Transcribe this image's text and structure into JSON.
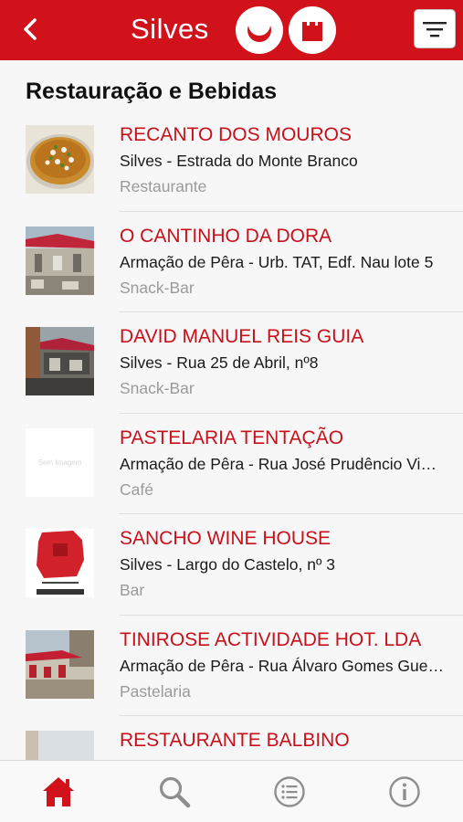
{
  "header": {
    "title": "Silves",
    "back_icon": "back-chevron-icon",
    "moon_icon": "crescent-moon-icon",
    "castle_icon": "castle-tower-icon",
    "filter_icon": "filter-icon",
    "color": "#d1121b"
  },
  "section": {
    "title": "Restauração e Bebidas"
  },
  "items": [
    {
      "name": "RECANTO DOS MOUROS",
      "address": "Silves - Estrada do Monte Branco",
      "category": "Restaurante"
    },
    {
      "name": "O CANTINHO DA DORA",
      "address": "Armação de Pêra - Urb. TAT, Edf. Nau lote 5",
      "category": "Snack-Bar"
    },
    {
      "name": "DAVID MANUEL REIS GUIA",
      "address": "Silves - Rua 25 de Abril, nº8",
      "category": "Snack-Bar"
    },
    {
      "name": "PASTELARIA TENTAÇÃO",
      "address": "Armação de Pêra - Rua José Prudêncio Vieira",
      "category": "Café",
      "image_placeholder": "Sem Imagem"
    },
    {
      "name": "SANCHO WINE HOUSE",
      "address": "Silves - Largo do Castelo, nº 3",
      "category": "Bar"
    },
    {
      "name": "TINIROSE ACTIVIDADE HOT. LDA",
      "address": "Armação de Pêra - Rua Álvaro Gomes Guerreiro",
      "category": "Pastelaria"
    },
    {
      "name": "RESTAURANTE BALBINO",
      "address": "",
      "category": ""
    }
  ],
  "tabbar": {
    "home_icon": "home-icon",
    "search_icon": "search-icon",
    "list_icon": "list-icon",
    "info_icon": "info-icon",
    "active_color": "#d1121b",
    "inactive_color": "#8e8e8e"
  }
}
